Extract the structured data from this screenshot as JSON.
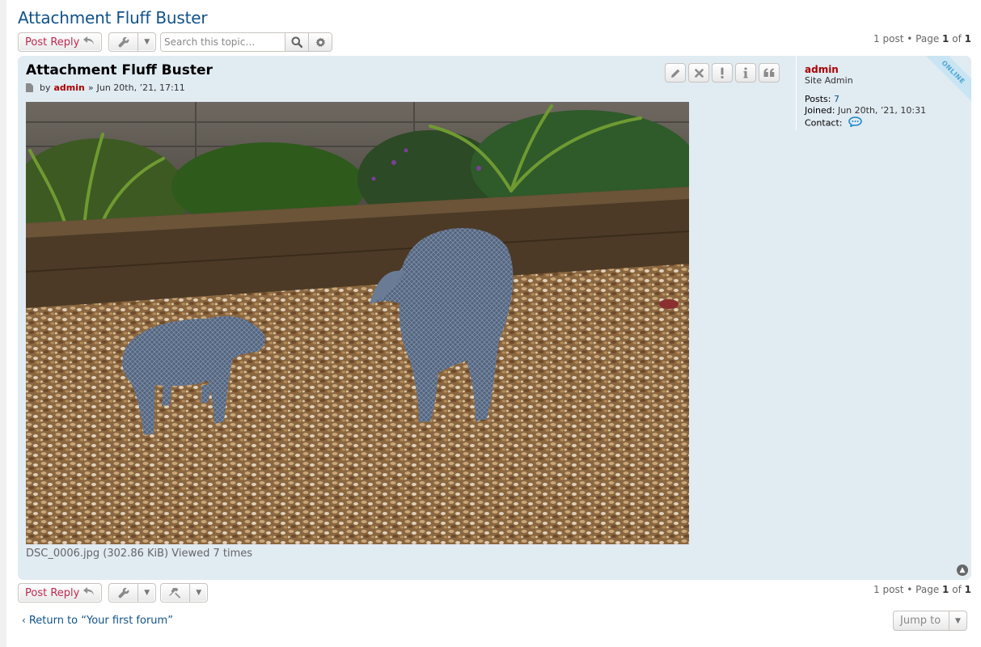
{
  "topic": {
    "title": "Attachment Fluff Buster"
  },
  "actions": {
    "post_reply": "Post Reply",
    "search_placeholder": "Search this topic…",
    "jump_to": "Jump to"
  },
  "pagination": {
    "count": "1 post",
    "sep": "•",
    "page_word": "Page",
    "current": "1",
    "of_word": "of",
    "total": "1"
  },
  "post": {
    "title": "Attachment Fluff Buster",
    "by": "by",
    "author": "admin",
    "sep": "»",
    "date": "Jun 20th, ’21, 17:11",
    "attachment_caption": "DSC_0006.jpg (302.86 KiB) Viewed 7 times"
  },
  "profile": {
    "username": "admin",
    "rank": "Site Admin",
    "posts_label": "Posts:",
    "posts_value": "7",
    "joined_label": "Joined:",
    "joined_value": "Jun 20th, ’21, 10:31",
    "contact_label": "Contact:",
    "status": "ONLINE"
  },
  "footer": {
    "return_text": "Return to “Your first forum”"
  },
  "icons": {
    "reply": "reply-icon",
    "wrench": "wrench-icon",
    "search": "search-icon",
    "gear": "gear-icon",
    "edit": "pencil-icon",
    "delete": "close-icon",
    "report": "exclamation-icon",
    "info": "info-icon",
    "quote": "quote-icon",
    "contact": "speech-bubble-icon",
    "top": "chevron-up-icon",
    "hammer": "hammer-icon"
  },
  "colors": {
    "link": "#105289",
    "reply_text": "#bc2a4d",
    "author": "#aa0000",
    "post_bg": "#e1ebf2",
    "online": "#4fa6d4"
  }
}
